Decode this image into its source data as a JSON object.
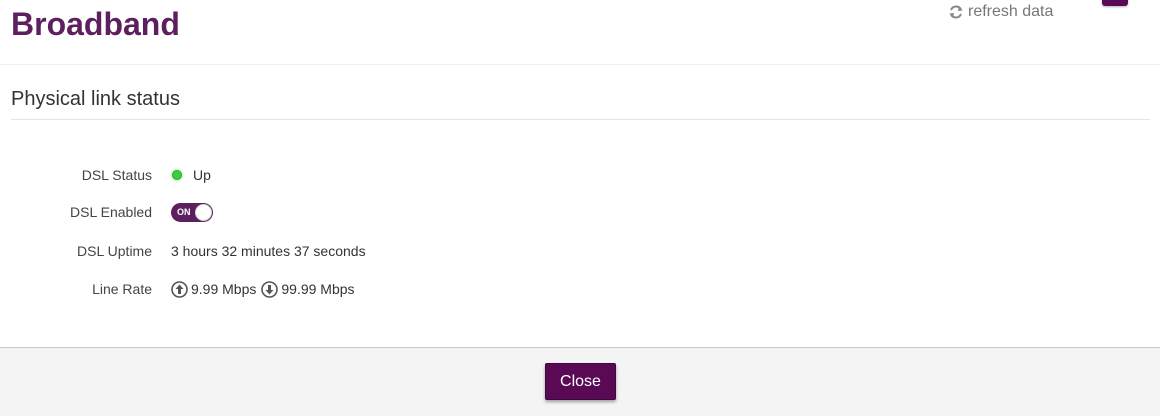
{
  "header": {
    "title": "Broadband",
    "refresh_label": "refresh data"
  },
  "section": {
    "title": "Physical link status"
  },
  "rows": {
    "dsl_status": {
      "label": "DSL Status",
      "value": "Up",
      "indicator_color": "#3ccd3c"
    },
    "dsl_enabled": {
      "label": "DSL Enabled",
      "toggle_text": "ON",
      "toggle_on": true
    },
    "dsl_uptime": {
      "label": "DSL Uptime",
      "value": "3 hours 32 minutes 37 seconds"
    },
    "line_rate": {
      "label": "Line Rate",
      "upload": "9.99 Mbps",
      "download": "99.99 Mbps"
    }
  },
  "footer": {
    "close_label": "Close"
  },
  "colors": {
    "brand": "#5e1f5e",
    "button": "#5a0a55",
    "status_up": "#3ccd3c"
  },
  "icons": {
    "refresh": "refresh-icon",
    "upload": "arrow-up-circle-icon",
    "download": "arrow-down-circle-icon"
  }
}
